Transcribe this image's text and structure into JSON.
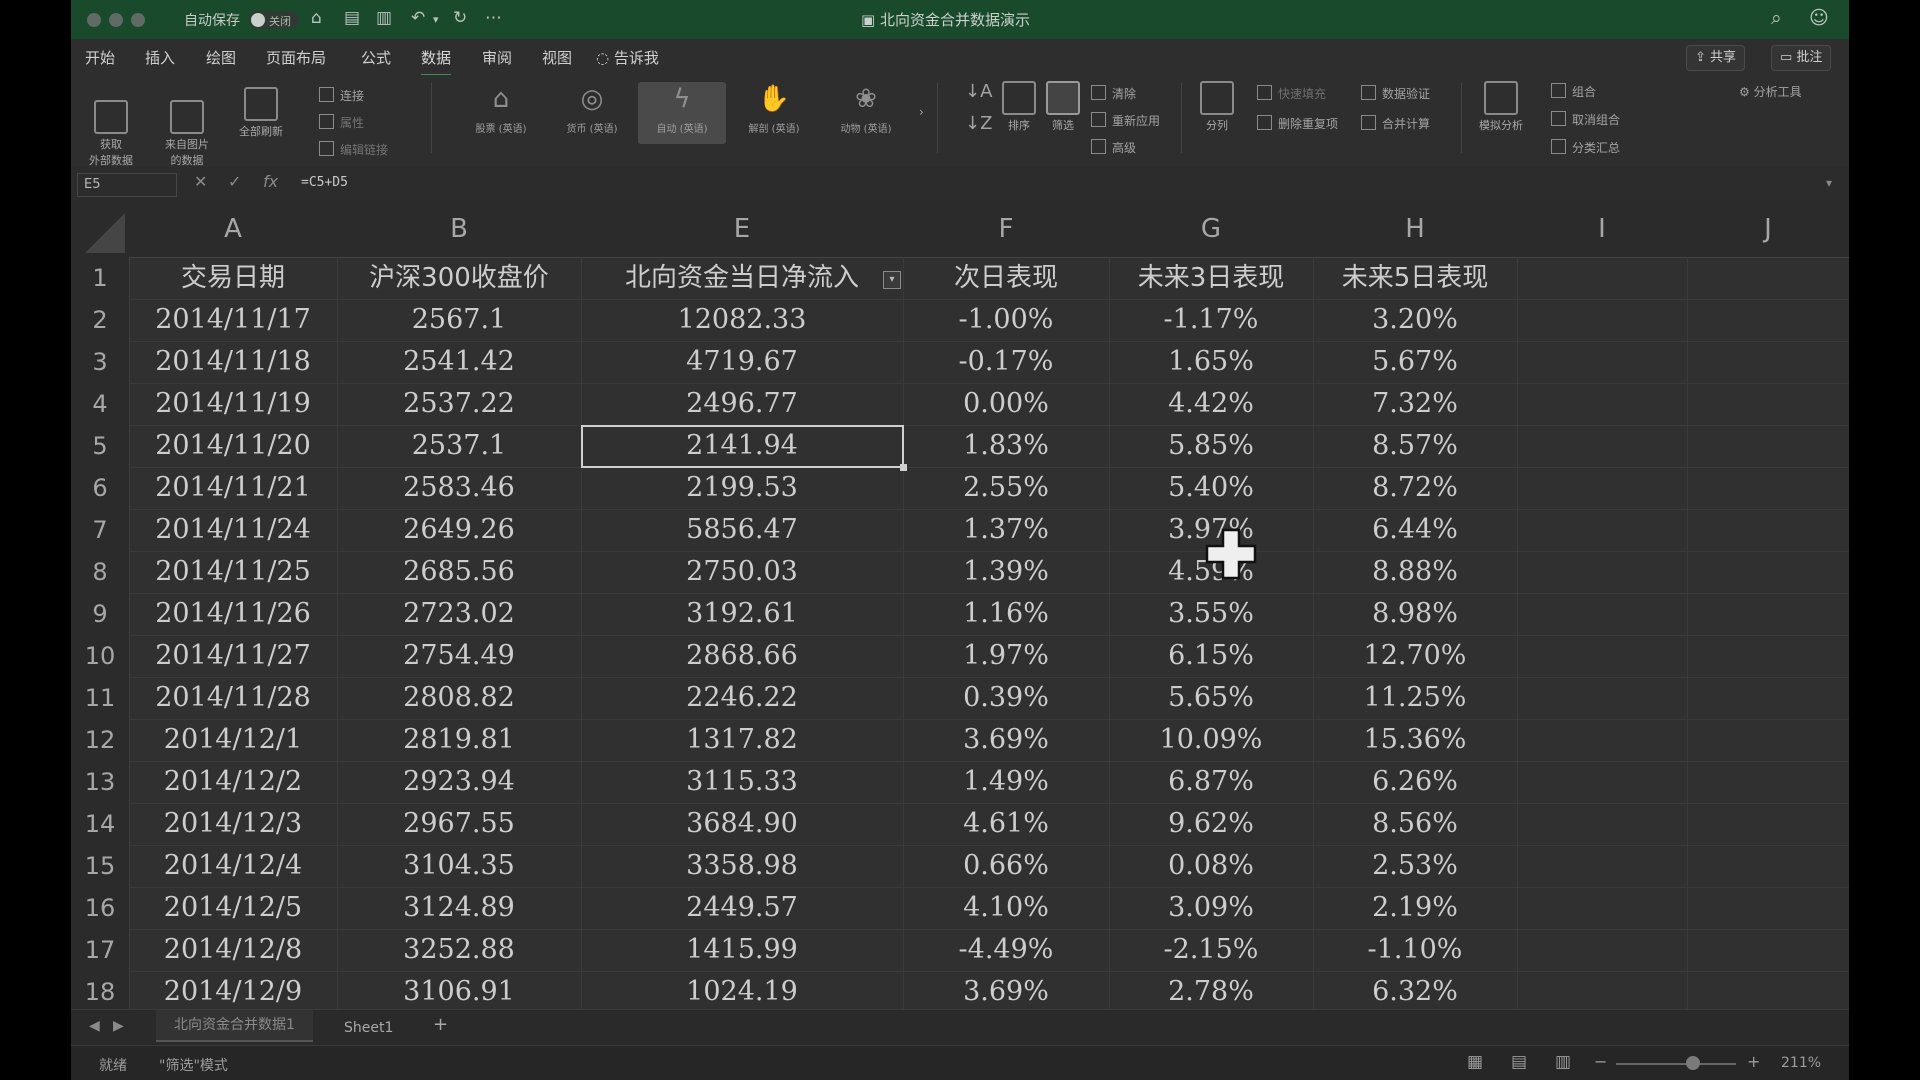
{
  "titlebar": {
    "autosave_label": "自动保存",
    "autosave_state": "关闭",
    "document_title": "北向资金合并数据演示"
  },
  "tabs": [
    "开始",
    "插入",
    "绘图",
    "页面布局",
    "公式",
    "数据",
    "审阅",
    "视图"
  ],
  "active_tab": "数据",
  "tell_me": "告诉我",
  "top_right": {
    "share": "共享",
    "comment": "批注"
  },
  "ribbon": {
    "get_data": "获取\n外部数据",
    "from_picture": "来自图片\n的数据",
    "refresh_all": "全部刷新",
    "connections": "连接",
    "properties": "属性",
    "edit_links": "编辑链接",
    "data_types": [
      "股票 (英语)",
      "货币 (英语)",
      "自动 (英语)",
      "解剖 (英语)",
      "动物 (英语)"
    ],
    "sort": "排序",
    "filter": "筛选",
    "clear": "清除",
    "reapply": "重新应用",
    "advanced": "高级",
    "split": "分列",
    "flash_fill": "快速填充",
    "remove_dup": "删除重复项",
    "data_validation": "数据验证",
    "consolidate": "合并计算",
    "what_if": "模拟分析",
    "group": "组合",
    "ungroup": "取消组合",
    "subtotal": "分类汇总",
    "analysis_tools": "分析工具"
  },
  "formula_bar": {
    "name_box": "E5",
    "formula": "=C5+D5"
  },
  "columns": [
    "A",
    "B",
    "E",
    "F",
    "G",
    "H",
    "I",
    "J"
  ],
  "rows": [
    [
      "交易日期",
      "沪深300收盘价",
      "北向资金当日净流入",
      "次日表现",
      "未来3日表现",
      "未来5日表现"
    ],
    [
      "2014/11/17",
      "2567.1",
      "12082.33",
      "-1.00%",
      "-1.17%",
      "3.20%"
    ],
    [
      "2014/11/18",
      "2541.42",
      "4719.67",
      "-0.17%",
      "1.65%",
      "5.67%"
    ],
    [
      "2014/11/19",
      "2537.22",
      "2496.77",
      "0.00%",
      "4.42%",
      "7.32%"
    ],
    [
      "2014/11/20",
      "2537.1",
      "2141.94",
      "1.83%",
      "5.85%",
      "8.57%"
    ],
    [
      "2014/11/21",
      "2583.46",
      "2199.53",
      "2.55%",
      "5.40%",
      "8.72%"
    ],
    [
      "2014/11/24",
      "2649.26",
      "5856.47",
      "1.37%",
      "3.97%",
      "6.44%"
    ],
    [
      "2014/11/25",
      "2685.56",
      "2750.03",
      "1.39%",
      "4.59%",
      "8.88%"
    ],
    [
      "2014/11/26",
      "2723.02",
      "3192.61",
      "1.16%",
      "3.55%",
      "8.98%"
    ],
    [
      "2014/11/27",
      "2754.49",
      "2868.66",
      "1.97%",
      "6.15%",
      "12.70%"
    ],
    [
      "2014/11/28",
      "2808.82",
      "2246.22",
      "0.39%",
      "5.65%",
      "11.25%"
    ],
    [
      "2014/12/1",
      "2819.81",
      "1317.82",
      "3.69%",
      "10.09%",
      "15.36%"
    ],
    [
      "2014/12/2",
      "2923.94",
      "3115.33",
      "1.49%",
      "6.87%",
      "6.26%"
    ],
    [
      "2014/12/3",
      "2967.55",
      "3684.90",
      "4.61%",
      "9.62%",
      "8.56%"
    ],
    [
      "2014/12/4",
      "3104.35",
      "3358.98",
      "0.66%",
      "0.08%",
      "2.53%"
    ],
    [
      "2014/12/5",
      "3124.89",
      "2449.57",
      "4.10%",
      "3.09%",
      "2.19%"
    ],
    [
      "2014/12/8",
      "3252.88",
      "1415.99",
      "-4.49%",
      "-2.15%",
      "-1.10%"
    ],
    [
      "2014/12/9",
      "3106.91",
      "1024.19",
      "3.69%",
      "2.78%",
      "6.32%"
    ]
  ],
  "row_numbers": [
    "1",
    "2",
    "3",
    "4",
    "5",
    "6",
    "7",
    "8",
    "9",
    "10",
    "11",
    "12",
    "13",
    "14",
    "15",
    "16",
    "17",
    "18"
  ],
  "sheets": [
    "北向资金合并数据1",
    "Sheet1"
  ],
  "add_sheet": "+",
  "status": {
    "ready": "就绪",
    "mode": "\"筛选\"模式",
    "zoom": "211%"
  }
}
